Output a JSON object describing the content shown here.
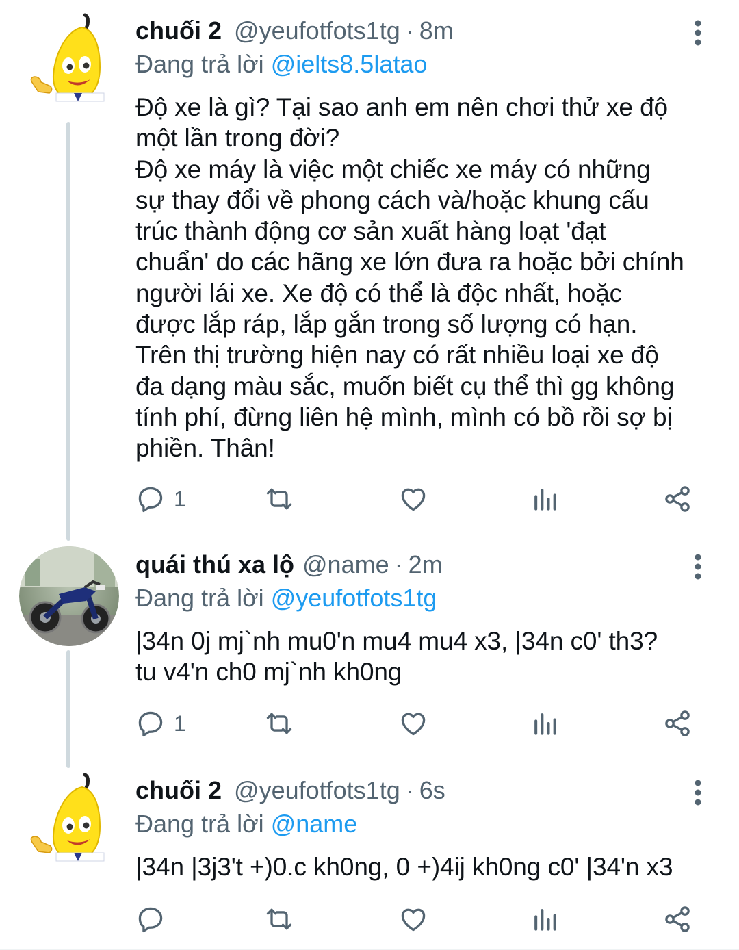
{
  "thread": [
    {
      "avatar_icon": "banana-avatar-icon",
      "display_name": "chuối 2",
      "handle": "@yeufotfots1tg",
      "separator": "·",
      "time": "8m",
      "replying_prefix": "Đang trả lời",
      "replying_to": "@ielts8.5latao",
      "text": "Độ xe là gì? Tại sao anh em nên chơi thử xe độ\nmột lần trong đời?\nĐộ xe máy là việc một chiếc xe máy có những\nsự thay đổi về phong cách và/hoặc khung cấu\ntrúc thành động cơ sản xuất hàng loạt 'đạt\nchuẩn' do các hãng xe lớn đưa ra hoặc bởi chính\nngười lái xe. Xe độ có thể là độc nhất, hoặc\nđược lắp ráp, lắp gắn trong số lượng có hạn.\nTrên thị trường hiện nay có rất nhiều loại xe độ\nđa dạng màu sắc, muốn biết cụ thể thì gg không\ntính phí, đừng liên hệ mình, mình có bồ rồi sợ bị\nphiền. Thân!",
      "reply_count": "1"
    },
    {
      "avatar_icon": "motorbike-photo-avatar",
      "display_name": "quái thú xa lộ",
      "handle": "@name",
      "separator": "·",
      "time": "2m",
      "replying_prefix": "Đang trả lời",
      "replying_to": "@yeufotfots1tg",
      "text": "|34n 0j mj`nh mu0'n mu4 mu4 x3, |34n c0' th3?\ntu v4'n ch0 mj`nh kh0ng",
      "reply_count": "1"
    },
    {
      "avatar_icon": "banana-avatar-icon",
      "display_name": "chuối 2",
      "handle": "@yeufotfots1tg",
      "separator": "·",
      "time": "6s",
      "replying_prefix": "Đang trả lời",
      "replying_to": "@name",
      "text": "|34n |3j3't +)0.c kh0ng, 0 +)4ij kh0ng c0' |34'n x3",
      "reply_count": ""
    }
  ],
  "icons": {
    "reply": "comment-icon",
    "retweet": "retweet-icon",
    "like": "heart-icon",
    "analytics": "analytics-icon",
    "share": "share-icon",
    "more": "more-vertical-icon"
  },
  "colors": {
    "text": "#0f1419",
    "secondary": "#536471",
    "link": "#1d9bf0",
    "thread_line": "#cfd9de"
  }
}
